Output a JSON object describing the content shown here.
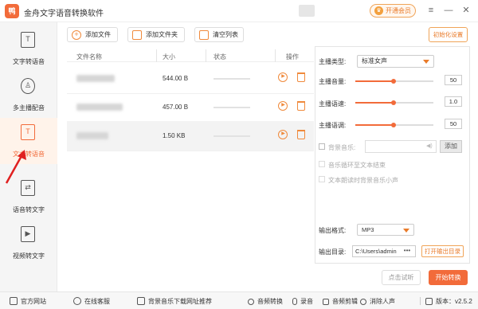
{
  "app": {
    "logo_glyph": "鸭",
    "title": "金舟文字语音转换软件",
    "vip_label": "开通会员",
    "vip_glyph": "♛"
  },
  "window": {
    "menu_glyph": "≡",
    "minimize_glyph": "—",
    "close_glyph": "✕"
  },
  "sidebar": {
    "items": [
      {
        "label": "文字转语音",
        "glyph": "T"
      },
      {
        "label": "多主播配音",
        "glyph": "♙"
      },
      {
        "label": "文本转语音",
        "glyph": "T",
        "active": true
      },
      {
        "label": "语音转文字",
        "glyph": "⇄"
      },
      {
        "label": "视频转文字",
        "glyph": "▶"
      }
    ]
  },
  "toolbar": {
    "add_file": "添加文件",
    "add_folder": "添加文件夹",
    "clear_list": "清空列表",
    "reset_settings": "初始化设置",
    "add_glyph": "+"
  },
  "table": {
    "headers": {
      "name": "文件名称",
      "size": "大小",
      "status": "状态",
      "actions": "操作"
    },
    "rows": [
      {
        "size": "544.00 B"
      },
      {
        "size": "457.00 B"
      },
      {
        "size": "1.50 KB"
      }
    ],
    "play_glyph": "▶"
  },
  "settings": {
    "voice_type_label": "主播类型:",
    "voice_type_value": "标准女声",
    "volume_label": "主播音量:",
    "volume_value": "50",
    "speed_label": "主播语速:",
    "speed_value": "1.0",
    "pitch_label": "主播语调:",
    "pitch_value": "50",
    "bgm_label": "背景音乐:",
    "add_bgm": "添加",
    "loop_option": "音乐循环至文本结束",
    "bgm_quiet_option": "文本朗读时背景音乐小声",
    "format_label": "输出格式:",
    "format_value": "MP3",
    "dir_label": "输出目录:",
    "dir_value": "C:\\Users\\admin",
    "dir_more": "•••",
    "open_output": "打开输出目录",
    "volume_glyph": "◀)"
  },
  "actions": {
    "trial": "点击试听",
    "start": "开始转换"
  },
  "footer": {
    "website": "官方网站",
    "support": "在线客服",
    "bgm_download": "背景音乐下载网址推荐",
    "audio_convert": "音频转换",
    "record": "录音",
    "audio_cut": "音频剪辑",
    "vocal_remove": "消除人声",
    "version": "版本：v2.5.2"
  },
  "colors": {
    "accent": "#f26b3a",
    "annotation": "#e02020"
  }
}
